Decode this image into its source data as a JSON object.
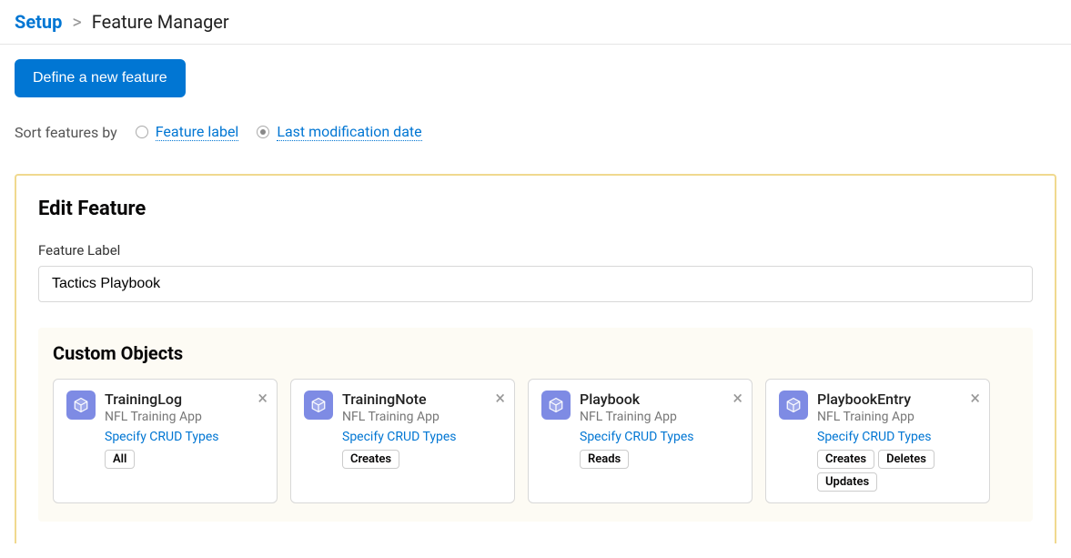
{
  "breadcrumb": {
    "root": "Setup",
    "separator": ">",
    "current": "Feature Manager"
  },
  "buttons": {
    "define_feature": "Define a new feature"
  },
  "sort": {
    "label": "Sort features by",
    "options": [
      {
        "label": "Feature label",
        "selected": false
      },
      {
        "label": "Last modification date",
        "selected": true
      }
    ]
  },
  "edit": {
    "heading": "Edit Feature",
    "field_label": "Feature Label",
    "field_value": "Tactics Playbook"
  },
  "custom_objects": {
    "heading": "Custom Objects",
    "crud_link_label": "Specify CRUD Types",
    "items": [
      {
        "title": "TrainingLog",
        "subtitle": "NFL Training App",
        "tags": [
          "All"
        ]
      },
      {
        "title": "TrainingNote",
        "subtitle": "NFL Training App",
        "tags": [
          "Creates"
        ]
      },
      {
        "title": "Playbook",
        "subtitle": "NFL Training App",
        "tags": [
          "Reads"
        ]
      },
      {
        "title": "PlaybookEntry",
        "subtitle": "NFL Training App",
        "tags": [
          "Creates",
          "Deletes",
          "Updates"
        ]
      }
    ]
  }
}
